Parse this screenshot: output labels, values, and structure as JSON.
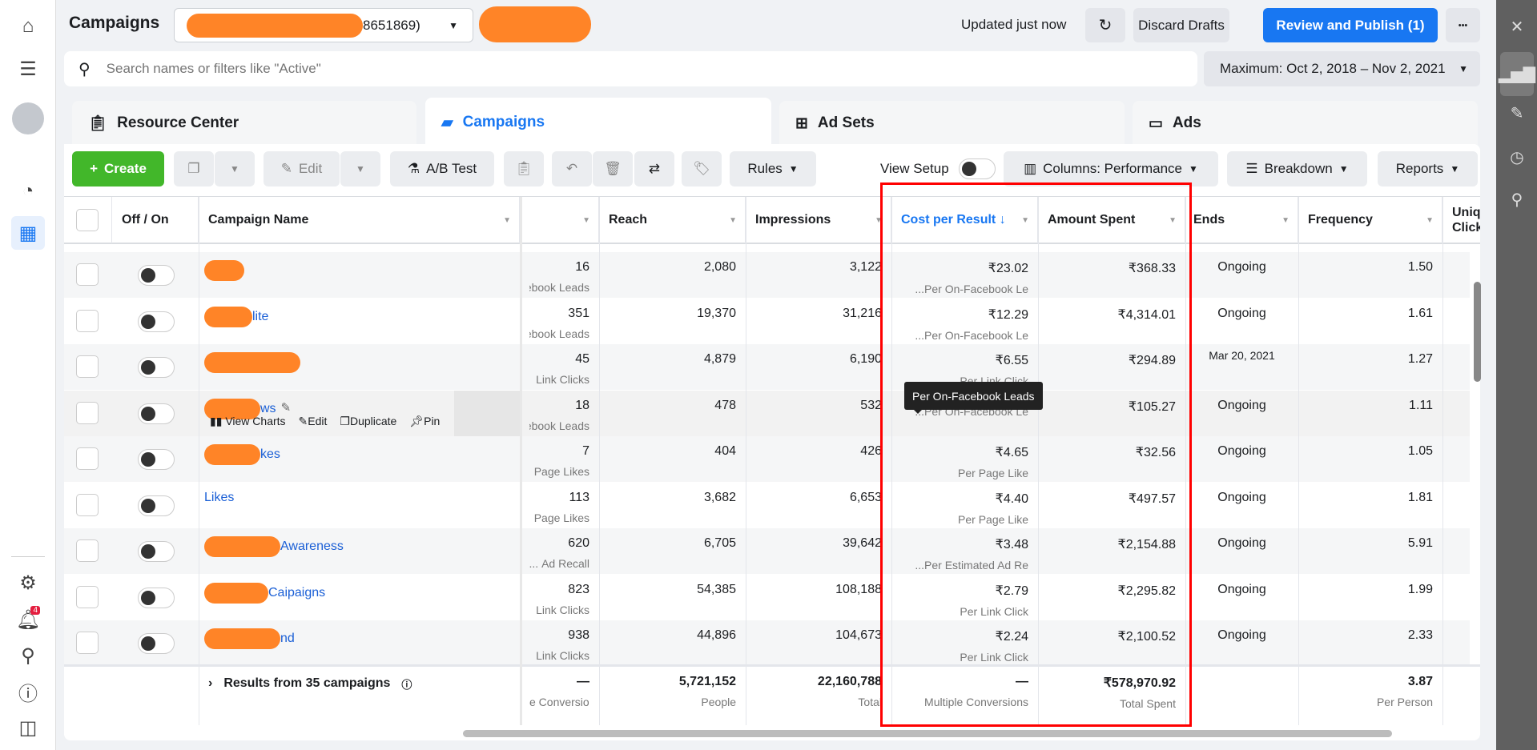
{
  "header": {
    "title": "Campaigns",
    "account_visible": "8651869)",
    "updated": "Updated just now",
    "discard": "Discard Drafts",
    "publish": "Review and Publish (1)",
    "more": "•••"
  },
  "search": {
    "placeholder": "Search names or filters like \"Active\"",
    "date_range": "Maximum: Oct 2, 2018 – Nov 2, 2021"
  },
  "tabs": [
    {
      "label": "Resource Center"
    },
    {
      "label": "Campaigns",
      "active": true
    },
    {
      "label": "Ad Sets"
    },
    {
      "label": "Ads"
    }
  ],
  "toolbar": {
    "create": "Create",
    "edit": "Edit",
    "ab_test": "A/B Test",
    "rules": "Rules",
    "view_setup": "View Setup",
    "columns": "Columns: Performance",
    "breakdown": "Breakdown",
    "reports": "Reports"
  },
  "columns": {
    "off_on": "Off / On",
    "name": "Campaign Name",
    "reach": "Reach",
    "impressions": "Impressions",
    "cost": "Cost per Result ↓",
    "spent": "Amount Spent",
    "ends": "Ends",
    "frequency": "Frequency",
    "unique": "Uniqu Click"
  },
  "rows": [
    {
      "name": "",
      "results": "16",
      "results_sub": "ebook Leads",
      "reach": "2,080",
      "impressions": "3,122",
      "cost": "₹23.02",
      "cost_sub": "Per On-Facebook Le...",
      "spent": "₹368.33",
      "ends": "Ongoing",
      "frequency": "1.50"
    },
    {
      "name": "lite",
      "results": "351",
      "results_sub": "ebook Leads",
      "reach": "19,370",
      "impressions": "31,216",
      "cost": "₹12.29",
      "cost_sub": "Per On-Facebook Le...",
      "spent": "₹4,314.01",
      "ends": "Ongoing",
      "frequency": "1.61"
    },
    {
      "name": "",
      "results": "45",
      "results_sub": "Link Clicks",
      "reach": "4,879",
      "impressions": "6,190",
      "cost": "₹6.55",
      "cost_sub": "Per Link Click",
      "spent": "₹294.89",
      "ends": "Mar 20, 2021",
      "frequency": "1.27"
    },
    {
      "name": "ws",
      "results": "18",
      "results_sub": "On-Facebook Leads",
      "reach": "478",
      "impressions": "532",
      "cost": "",
      "cost_sub": "Per On-Facebook Le...",
      "spent": "₹105.27",
      "ends": "Ongoing",
      "frequency": "1.11",
      "hover": true
    },
    {
      "name": "kes",
      "results": "7",
      "results_sub": "Page Likes",
      "reach": "404",
      "impressions": "426",
      "cost": "₹4.65",
      "cost_sub": "Per Page Like",
      "spent": "₹32.56",
      "ends": "Ongoing",
      "frequency": "1.05"
    },
    {
      "name": "Likes",
      "results": "113",
      "results_sub": "Page Likes",
      "reach": "3,682",
      "impressions": "6,653",
      "cost": "₹4.40",
      "cost_sub": "Per Page Like",
      "spent": "₹497.57",
      "ends": "Ongoing",
      "frequency": "1.81"
    },
    {
      "name": "Awareness",
      "results": "620",
      "results_sub": "Ad Recall ...",
      "reach": "6,705",
      "impressions": "39,642",
      "cost": "₹3.48",
      "cost_sub": "Per Estimated Ad Re...",
      "spent": "₹2,154.88",
      "ends": "Ongoing",
      "frequency": "5.91"
    },
    {
      "name": "Caipaigns",
      "results": "823",
      "results_sub": "Link Clicks",
      "reach": "54,385",
      "impressions": "108,188",
      "cost": "₹2.79",
      "cost_sub": "Per Link Click",
      "spent": "₹2,295.82",
      "ends": "Ongoing",
      "frequency": "1.99"
    },
    {
      "name": "nd",
      "results": "938",
      "results_sub": "Link Clicks",
      "reach": "44,896",
      "impressions": "104,673",
      "cost": "₹2.24",
      "cost_sub": "Per Link Click",
      "spent": "₹2,100.52",
      "ends": "Ongoing",
      "frequency": "2.33"
    }
  ],
  "row_actions": {
    "view_charts": "View Charts",
    "edit": "Edit",
    "duplicate": "Duplicate",
    "pin": "Pin"
  },
  "tooltip": "Per On-Facebook Leads",
  "totals": {
    "label": "Results from 35 campaigns",
    "results": "—",
    "results_sub": "e Conversions",
    "reach": "5,721,152",
    "reach_sub": "People",
    "impressions": "22,160,788",
    "impressions_sub": "Total",
    "cost": "—",
    "cost_sub": "Multiple Conversions",
    "spent": "₹578,970.92",
    "spent_sub": "Total Spent",
    "frequency": "3.87",
    "frequency_sub": "Per Person"
  },
  "sidebar": {
    "notification_count": "4"
  },
  "colors": {
    "accent": "#1877f2",
    "create": "#42b72a",
    "highlight_box": "#ff0000",
    "link": "#1a5fd6"
  }
}
